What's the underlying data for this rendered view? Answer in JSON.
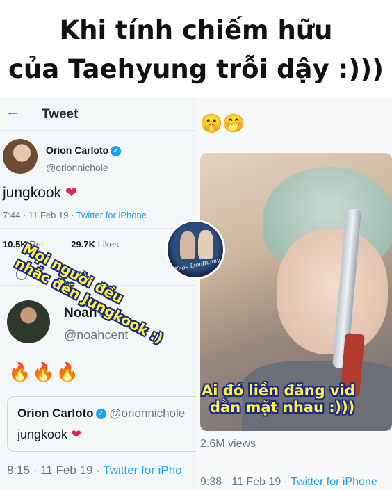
{
  "meme": {
    "title_line1": "Khi tính chiếm hữu",
    "title_line2": "của Taehyung trỗi dậy :)))"
  },
  "left_tweet": {
    "header_title": "Tweet",
    "back_icon": "back-arrow-icon",
    "author_name": "Orion Carloto",
    "author_handle": "@orionnichole",
    "text": "jungkook",
    "heart": "❤",
    "time": "7:44 · 11 Feb 19 · ",
    "source": "Twitter for iPhone",
    "retweets_count": "10.5K",
    "retweets_label": "Ret",
    "likes_count": "29.7K",
    "likes_label": "Likes",
    "reply_icon": "reply-icon"
  },
  "reply_tweet": {
    "author_name": "Noah",
    "author_handle": "@noahcent",
    "emojis": "🔥🔥🔥",
    "quoted_name": "Orion Carloto",
    "quoted_handle": "@orionnichole",
    "quoted_text": "jungkook",
    "time": "8:15 · 11 Feb 19 · ",
    "source": "Twitter for iPho"
  },
  "right_panel": {
    "emojis": "🤫🤭",
    "views": "2.6M views",
    "time": "9:38 · 11 Feb 19 · ",
    "source": "Twitter for iPhone"
  },
  "watermark": {
    "text": "VKook LionBunny"
  },
  "captions": {
    "left_line1": "Mọi người đều",
    "left_line2": "nhắc đến Jungkook :)",
    "right_line1": "Ai đó liền đăng vid",
    "right_line2": "dằn mặt nhau :)))"
  }
}
